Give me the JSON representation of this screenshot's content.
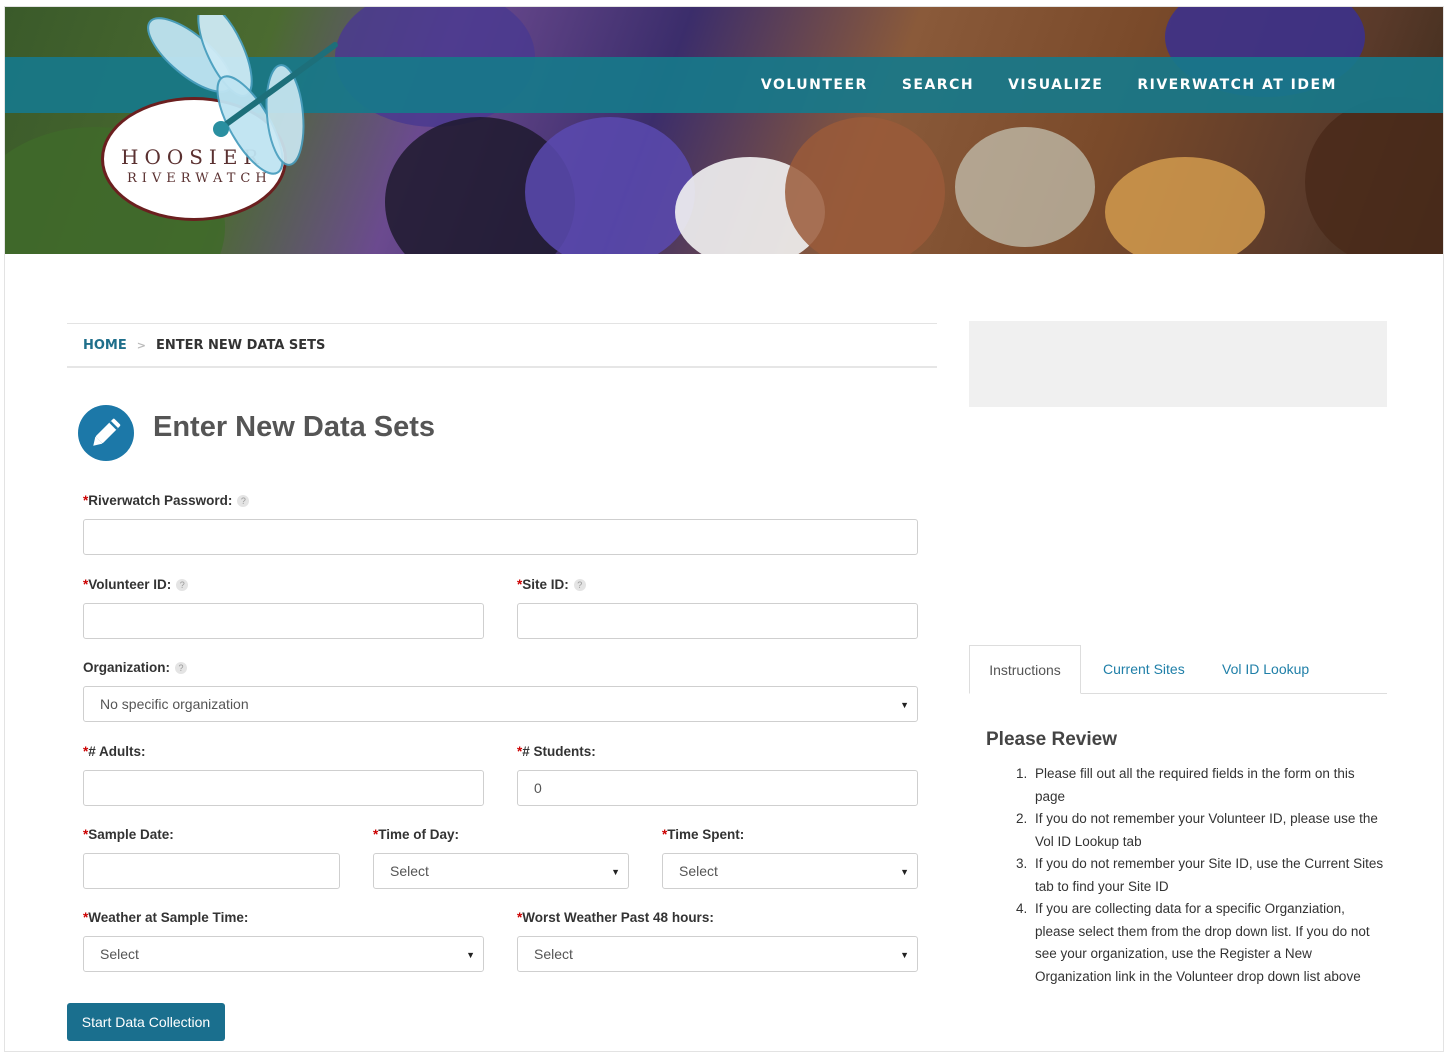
{
  "nav": {
    "items": [
      "VOLUNTEER",
      "SEARCH",
      "VISUALIZE",
      "RIVERWATCH AT IDEM"
    ]
  },
  "logo": {
    "line1": "HOOSIER",
    "line2": "RIVERWATCH"
  },
  "breadcrumb": {
    "home": "HOME",
    "separator": ">",
    "current": "ENTER NEW DATA SETS"
  },
  "page": {
    "title": "Enter New Data Sets"
  },
  "form": {
    "riverwatch_password": {
      "label": "Riverwatch Password:",
      "value": ""
    },
    "volunteer_id": {
      "label": "Volunteer ID:",
      "value": ""
    },
    "site_id": {
      "label": "Site ID:",
      "value": ""
    },
    "organization": {
      "label": "Organization:",
      "selected": "No specific organization"
    },
    "adults": {
      "label": "# Adults:",
      "value": ""
    },
    "students": {
      "label": "# Students:",
      "value": "0"
    },
    "sample_date": {
      "label": "Sample Date:",
      "value": ""
    },
    "time_of_day": {
      "label": "Time of Day:",
      "selected": "Select"
    },
    "time_spent": {
      "label": "Time Spent:",
      "selected": "Select"
    },
    "weather_sample": {
      "label": "Weather at Sample Time:",
      "selected": "Select"
    },
    "worst_weather": {
      "label": "Worst Weather Past 48 hours:",
      "selected": "Select"
    },
    "required_mark": "*",
    "help_mark": "?",
    "submit_label": "Start Data Collection"
  },
  "sidebar": {
    "tabs": [
      "Instructions",
      "Current Sites",
      "Vol ID Lookup"
    ],
    "review_title": "Please Review",
    "review_items": [
      "Please fill out all the required fields in the form on this page",
      "If you do not remember your Volunteer ID, please use the Vol ID Lookup tab",
      "If you do not remember your Site ID, use the Current Sites tab to find your Site ID",
      "If you are collecting data for a specific Organziation, please select them from the drop down list. If you do not see your organization, use the Register a New Organization link in the Volunteer drop down list above"
    ]
  },
  "colors": {
    "nav_bar": "#17788a",
    "accent": "#1a6f8e",
    "link": "#1f7fa8",
    "required": "#cc0000"
  }
}
